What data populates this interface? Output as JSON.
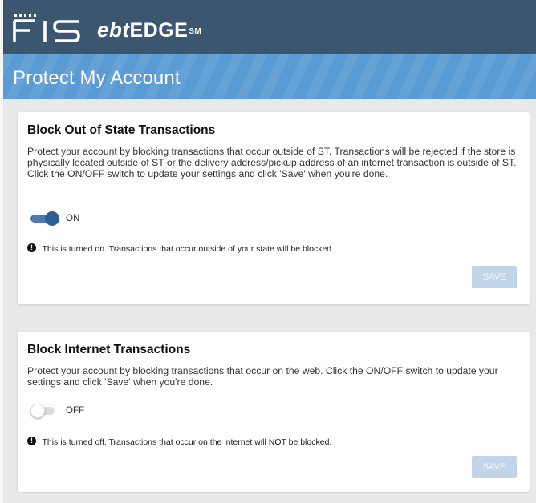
{
  "brand": {
    "logo_text": "FIS",
    "product_prefix": "ebt",
    "product_suffix": "EDGE",
    "service_mark": "SM"
  },
  "page": {
    "title": "Protect My Account"
  },
  "sections": [
    {
      "title": "Block Out of State Transactions",
      "description": "Protect your account by blocking transactions that occur outside of  ST. Transactions will be rejected if the store is physically located outside of  ST or the delivery address/pickup address of an internet transaction is outside of  ST. Click the ON/OFF switch to update your settings and click 'Save' when you're done.",
      "toggle_state": "on",
      "toggle_label": "ON",
      "notice_icon": "info-icon",
      "notice_icon_glyph": "!",
      "notice": "This is turned on. Transactions that occur outside of your state will be blocked.",
      "save_label": "SAVE",
      "save_enabled": false
    },
    {
      "title": "Block Internet Transactions",
      "description": "Protect your account by blocking transactions that occur on the web. Click the ON/OFF switch to update your settings and click 'Save' when you're done.",
      "toggle_state": "off",
      "toggle_label": "OFF",
      "notice_icon": "info-icon",
      "notice_icon_glyph": "!",
      "notice": "This is turned off. Transactions that occur on the internet will NOT be blocked.",
      "save_label": "SAVE",
      "save_enabled": false
    }
  ],
  "colors": {
    "brand_bar": "#3b5770",
    "title_bar": "#5a9bd3",
    "toggle_on": "#2f5e94",
    "save_disabled": "#c2d4ea"
  }
}
